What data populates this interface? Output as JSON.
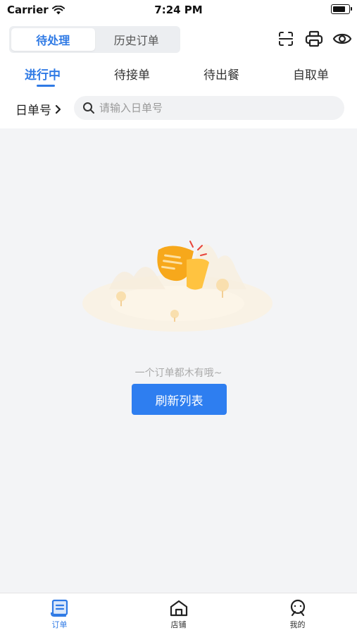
{
  "status_bar": {
    "carrier": "Carrier",
    "time": "7:24 PM"
  },
  "segment": {
    "options": [
      "待处理",
      "历史订单"
    ],
    "active_index": 0
  },
  "top_icons": [
    "scan-icon",
    "printer-icon",
    "eye-icon"
  ],
  "tabs": {
    "items": [
      "进行中",
      "待接单",
      "待出餐",
      "自取单"
    ],
    "active_index": 0
  },
  "search": {
    "label": "日单号",
    "placeholder": "请输入日单号"
  },
  "empty_state": {
    "message": "一个订单都木有哦~",
    "button_label": "刷新列表"
  },
  "tabbar": {
    "items": [
      {
        "label": "订单",
        "icon": "order-icon"
      },
      {
        "label": "店铺",
        "icon": "store-icon"
      },
      {
        "label": "我的",
        "icon": "profile-icon"
      }
    ],
    "active_index": 0
  },
  "colors": {
    "accent": "#2f7ae5",
    "button": "#2e7ef0",
    "background": "#f3f4f6",
    "illustration": "#f7a81b"
  }
}
